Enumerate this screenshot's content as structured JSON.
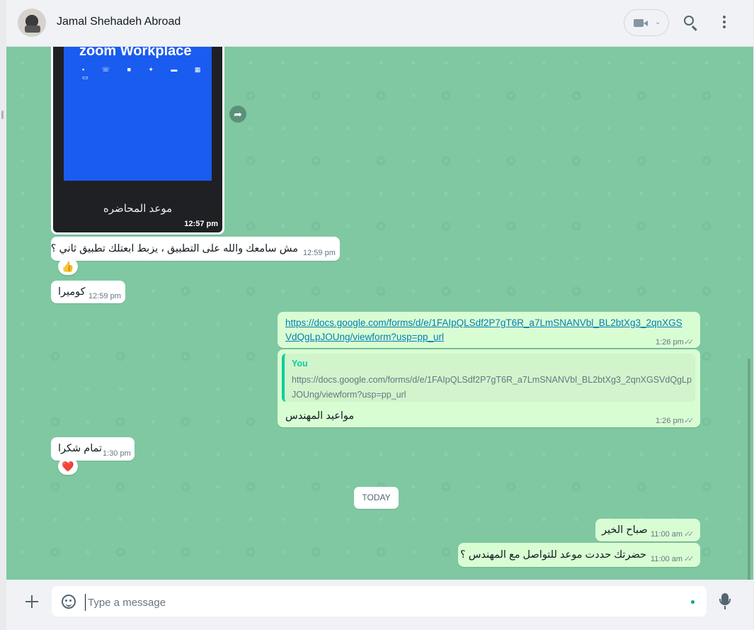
{
  "header": {
    "contact_name": "Jamal Shehadeh Abroad",
    "avatar_icon": "avatar",
    "video_icon": "video-camera-icon",
    "chevron": "⌄",
    "search_icon": "search-icon",
    "menu_icon": "menu-icon"
  },
  "messages": [
    {
      "dir": "in",
      "type": "image",
      "image_title": "zoom Workplace",
      "caption": "موعد المحاضره",
      "time": "12:57 pm"
    },
    {
      "dir": "in",
      "type": "text",
      "text": "مش سامعك والله على التطبيق ، يزبط ابعتلك تطبيق ثاني ؟",
      "time": "12:59 pm",
      "reaction": "👍"
    },
    {
      "dir": "in",
      "type": "text",
      "text": "كوميرا",
      "time": "12:59 pm"
    },
    {
      "dir": "out",
      "type": "link",
      "text_line1": "https://docs.google.com/forms/d/e/1FAIpQLSdf2P7gT6R_a7LmSNANVbl_BL2btXg3_2qnXGS",
      "text_line2": "VdQgLpJOUng/viewform?usp=pp_url",
      "time": "1:26 pm"
    },
    {
      "dir": "out",
      "type": "reply",
      "quote_author": "You",
      "quote_text": "https://docs.google.com/forms/d/e/1FAIpQLSdf2P7gT6R_a7LmSNANVbl_BL2btXg3_2qnXGSVdQgLpJOUng/viewform?usp=pp_url",
      "text": "مواعيد المهندس",
      "time": "1:26 pm"
    },
    {
      "dir": "in",
      "type": "text",
      "text": "تمام شكرا",
      "time": "1:30 pm",
      "reaction": "❤️"
    },
    {
      "dir": "out",
      "type": "text",
      "text": "صباح الخير",
      "time": "11:00 am"
    },
    {
      "dir": "out",
      "type": "text",
      "text": "حضرتك حددت موعد للتواصل مع المهندس ؟",
      "time": "11:00 am"
    }
  ],
  "date_divider": "TODAY",
  "ticks": "✓✓",
  "forward_glyph": "➦",
  "zoom_icon_glyphs": "▪ ☏ ■ ✦ ▬ ▦ ▭",
  "composer": {
    "placeholder": "Type a message"
  },
  "colors": {
    "chat_bg": "#7fc8a2",
    "outgoing_bubble": "#d9fdd3",
    "incoming_bubble": "#ffffff",
    "accent": "#06cf9c",
    "link": "#027eb5"
  }
}
